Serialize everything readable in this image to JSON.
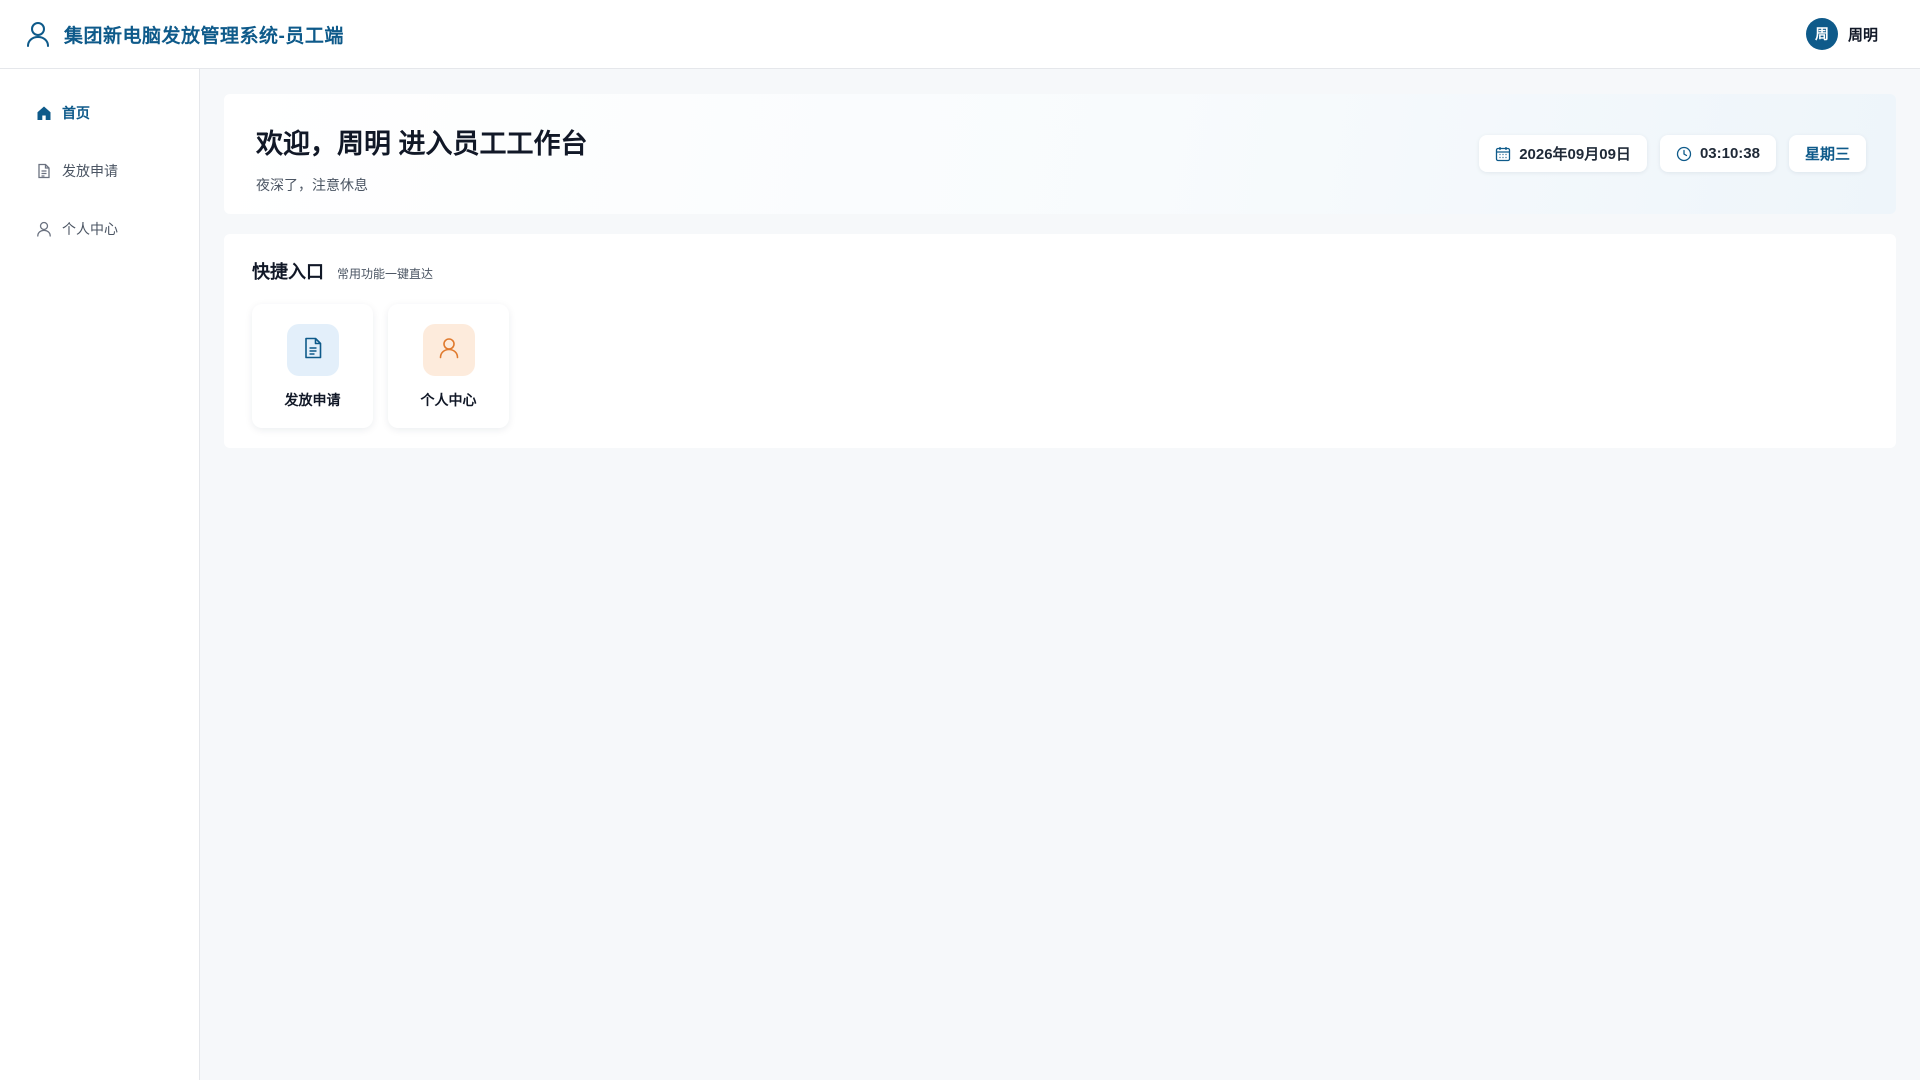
{
  "header": {
    "title": "集团新电脑发放管理系统-员工端",
    "brand_icon": "user-icon",
    "user": {
      "avatar_text": "周",
      "name": "周明"
    },
    "accent_color": "#0e5a8a"
  },
  "sidebar": {
    "items": [
      {
        "label": "首页",
        "icon": "home-icon",
        "active": true
      },
      {
        "label": "发放申请",
        "icon": "document-icon",
        "active": false
      },
      {
        "label": "个人中心",
        "icon": "user-icon",
        "active": false
      }
    ]
  },
  "welcome": {
    "title": "欢迎，周明 进入员工工作台",
    "subtitle": "夜深了，注意休息",
    "date": "2026年09月09日",
    "time": "03:10:38",
    "weekday": "星期三"
  },
  "quick": {
    "title": "快捷入口",
    "subtitle": "常用功能一键直达",
    "cards": [
      {
        "label": "发放申请",
        "icon": "document-icon",
        "color": "#e3effa"
      },
      {
        "label": "个人中心",
        "icon": "user-icon",
        "color": "#fdebdc"
      }
    ]
  }
}
